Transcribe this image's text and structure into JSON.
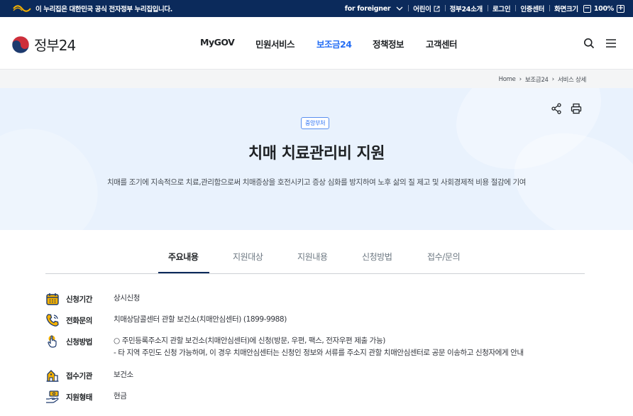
{
  "colors": {
    "navy": "#0b2a5b",
    "accent_blue": "#256ef4",
    "hero_bg": "#e9f2fd",
    "icon_yellow": "#f5b100",
    "icon_navy": "#1d3a6e"
  },
  "topbar": {
    "notice": "이 누리집은 대한민국 공식 전자정부 누리집입니다.",
    "for_foreigner": "for foreigner",
    "kids": "어린이",
    "about": "정부24소개",
    "login": "로그인",
    "certificate": "인증센터",
    "screen_size": "화면크기",
    "zoom": "100%",
    "zoom_minus": "−",
    "zoom_plus": "+"
  },
  "header": {
    "logo_text": "정부24",
    "menus": [
      "MyGOV",
      "민원서비스",
      "보조금24",
      "정책정보",
      "고객센터"
    ],
    "active_menu": "보조금24",
    "icons": [
      "search-icon",
      "hamburger-menu-icon"
    ]
  },
  "breadcrumb": [
    "Home",
    "보조금24",
    "서비스 상세"
  ],
  "hero": {
    "badge": "중앙부처",
    "title": "치매 치료관리비 지원",
    "description": "치매를 조기에 지속적으로 치료,관리함으로써 치매증상을 호전시키고 증상 심화를 방지하여 노후 삶의 질 제고 및 사회경제적 비용 절감에 기여",
    "icons": [
      "share-icon",
      "print-icon"
    ]
  },
  "tabs": [
    "주요내용",
    "지원대상",
    "지원내용",
    "신청방법",
    "접수/문의"
  ],
  "active_tab": "주요내용",
  "info": [
    {
      "label": "신청기간",
      "value": "상시신청",
      "icon": "calendar-icon"
    },
    {
      "label": "전화문의",
      "value": "치매상담콜센터 관할 보건소(치매안심센터) (1899-9988)",
      "icon": "phone-icon"
    },
    {
      "label": "신청방법",
      "value": "○ 주민등록주소지 관할 보건소(치매안심센터)에 신청(방문, 우편, 팩스, 전자우편 제출 가능)",
      "value2": "- 타 지역 주민도 신청 가능하며, 이 경우 치매안심센터는 신청인 정보와 서류를 주소지 관할 치매안심센터로 공문 이송하고 신청자에게 안내",
      "icon": "hand-click-icon"
    },
    {
      "label": "접수기관",
      "value": "보건소",
      "icon": "building-icon"
    },
    {
      "label": "지원형태",
      "value": "현금",
      "icon": "cash-hand-icon"
    }
  ]
}
